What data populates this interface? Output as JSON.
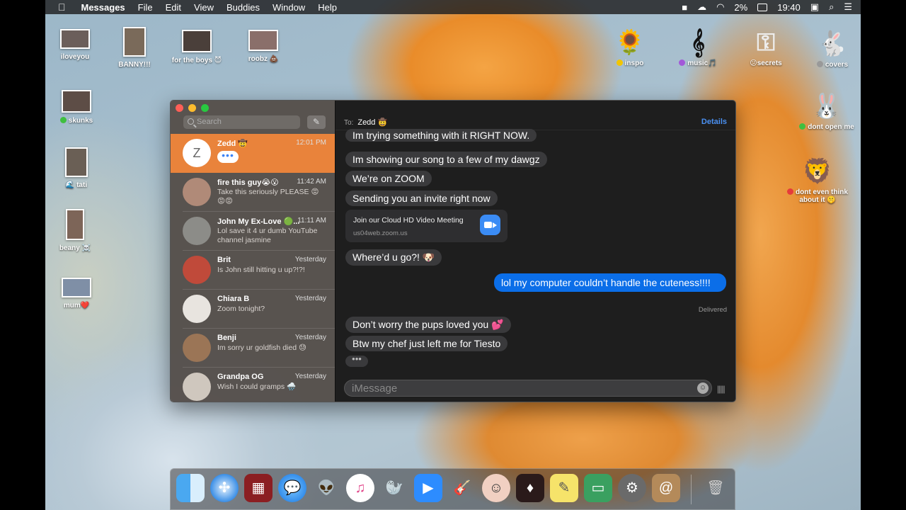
{
  "menubar": {
    "apple": "",
    "app": "Messages",
    "menus": [
      "File",
      "Edit",
      "View",
      "Buddies",
      "Window",
      "Help"
    ],
    "battery": "2%",
    "clock": "19:40"
  },
  "desktop": {
    "icons": [
      {
        "label": "iloveyou"
      },
      {
        "label": "BANNY!!!"
      },
      {
        "label": "for the boys 😈"
      },
      {
        "label": "roobz 💩"
      },
      {
        "label": "inspo"
      },
      {
        "label": "music🎵"
      },
      {
        "label": "😕secrets"
      },
      {
        "label": "covers"
      },
      {
        "label": "skunks"
      },
      {
        "label": "🌊 tati"
      },
      {
        "label": "beany ☠️"
      },
      {
        "label": "mum❤️"
      },
      {
        "label": "dont open me"
      },
      {
        "label": "dont even think about it 🤫"
      }
    ]
  },
  "sidebar": {
    "search_placeholder": "Search",
    "conversations": [
      {
        "name": "Zedd 🤠",
        "time": "12:01 PM",
        "avatar_letter": "Z",
        "preview": "",
        "selected": true
      },
      {
        "name": "fire this guy😭😮",
        "time": "11:42 AM",
        "preview": "Take this seriously PLEASE 😡 😡😡"
      },
      {
        "name": "John My Ex-Love 🟢...",
        "time": "11:11 AM",
        "preview": "Lol save it 4 ur dumb YouTube channel jasmine"
      },
      {
        "name": "Brit",
        "time": "Yesterday",
        "preview": "Is John still hitting u up?!?!"
      },
      {
        "name": "Chiara B",
        "time": "Yesterday",
        "preview": "Zoom tonight?"
      },
      {
        "name": "Benji",
        "time": "Yesterday",
        "preview": "Im sorry ur goldfish died 😓"
      },
      {
        "name": "Grandpa OG",
        "time": "Yesterday",
        "preview": "Wish I could gramps 🌧️"
      }
    ]
  },
  "conversation": {
    "to_label": "To:",
    "to_name": "Zedd 🤠",
    "details": "Details",
    "messages": [
      "Im trying something with it RIGHT NOW.",
      "Im showing our song to a few of my dawgz",
      "We’re on ZOOM",
      "Sending you an invite right now",
      "Where’d u go?! 🐶",
      "lol my computer couldn’t handle the cuteness!!!!",
      "Don’t worry the pups loved you 💕",
      "Btw my chef just left me for Tiesto"
    ],
    "link": {
      "title": "Join our Cloud HD Video Meeting",
      "url": "us04web.zoom.us"
    },
    "delivered": "Delivered",
    "input_placeholder": "iMessage"
  },
  "dock": {
    "apps": [
      "Finder",
      "Safari",
      "Photo Booth",
      "Messages",
      "Alien",
      "iTunes",
      "Seal",
      "Zoom",
      "Guitar",
      "Face",
      "Photo Booth 2",
      "Stickies",
      "Preview",
      "System Preferences",
      "Contacts",
      "Trash"
    ]
  }
}
